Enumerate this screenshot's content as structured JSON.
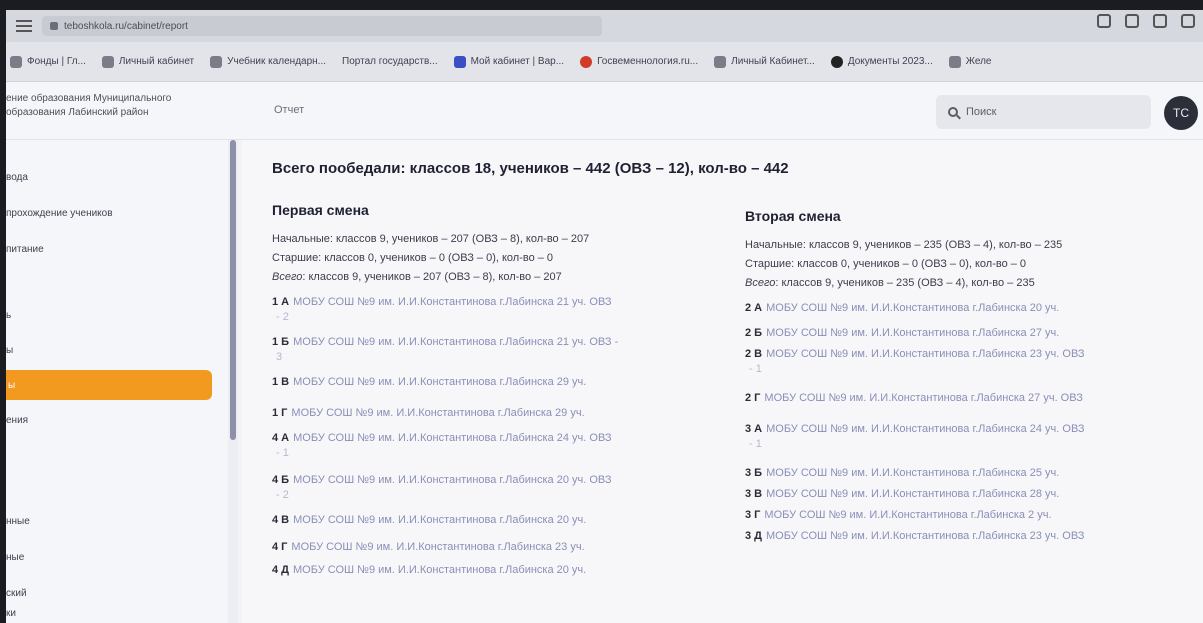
{
  "browser": {
    "url": "teboshkola.ru/cabinet/report",
    "bookmarks": [
      "Фонды | Гл...",
      "Личный кабинет",
      "Учебник календарн...",
      "Портал государств...",
      "Мой кабинет | Вар...",
      "Госвеменнология.ru...",
      "Личный Кабинет...",
      "Документы 2023...",
      "Желе"
    ]
  },
  "header": {
    "org_name": "ение образования Муниципального образования Лабинский район",
    "breadcrumb": "Отчет",
    "search_placeholder": "Поиск",
    "avatar_initials": "ТС"
  },
  "sidebar": {
    "items": [
      "вода",
      "прохождение учеников",
      "питание",
      "ь",
      "ы",
      "ы",
      "ения",
      "нные",
      "ные",
      "ский",
      "ки"
    ]
  },
  "report": {
    "summary": "Всего пообедали: классов 18, учеников – 442 (ОВЗ – 12), кол-во – 442",
    "first_shift": {
      "title": "Первая смена",
      "primary": "Начальные: классов 9, учеников – 207 (ОВЗ – 8), кол-во – 207",
      "senior": "Старшие: классов 0, учеников – 0 (ОВЗ – 0), кол-во – 0",
      "total_label": "Всего",
      "total": ": классов 9, учеников – 207 (ОВЗ – 8), кол-во – 207",
      "classes": [
        {
          "code": "1 А",
          "text": "МОБУ СОШ №9 им. И.И.Константинова г.Лабинска 21 уч. ОВЗ",
          "sub": "- 2"
        },
        {
          "code": "1 Б",
          "text": "МОБУ СОШ №9 им. И.И.Константинова г.Лабинска 21 уч. ОВЗ -",
          "sub": "3"
        },
        {
          "code": "1 В",
          "text": "МОБУ СОШ №9 им. И.И.Константинова г.Лабинска 29 уч.",
          "sub": ""
        },
        {
          "code": "1 Г",
          "text": "МОБУ СОШ №9 им. И.И.Константинова г.Лабинска 29 уч.",
          "sub": ""
        },
        {
          "code": "4 А",
          "text": "МОБУ СОШ №9 им. И.И.Константинова г.Лабинска 24 уч. ОВЗ",
          "sub": "- 1"
        },
        {
          "code": "4 Б",
          "text": "МОБУ СОШ №9 им. И.И.Константинова г.Лабинска 20 уч. ОВЗ",
          "sub": "- 2"
        },
        {
          "code": "4 В",
          "text": "МОБУ СОШ №9 им. И.И.Константинова г.Лабинска 20 уч.",
          "sub": ""
        },
        {
          "code": "4 Г",
          "text": "МОБУ СОШ №9 им. И.И.Константинова г.Лабинска 23 уч.",
          "sub": ""
        },
        {
          "code": "4 Д",
          "text": "МОБУ СОШ №9 им. И.И.Константинова г.Лабинска 20 уч.",
          "sub": ""
        }
      ]
    },
    "second_shift": {
      "title": "Вторая смена",
      "primary": "Начальные: классов 9, учеников – 235 (ОВЗ – 4), кол-во – 235",
      "senior": "Старшие: классов 0, учеников – 0 (ОВЗ – 0), кол-во – 0",
      "total_label": "Всего",
      "total": ": классов 9, учеников – 235 (ОВЗ – 4), кол-во – 235",
      "classes": [
        {
          "code": "2 А",
          "text": "МОБУ СОШ №9 им. И.И.Константинова г.Лабинска 20 уч.",
          "sub": ""
        },
        {
          "code": "2 Б",
          "text": "МОБУ СОШ №9 им. И.И.Константинова г.Лабинска 27 уч.",
          "sub": ""
        },
        {
          "code": "2 В",
          "text": "МОБУ СОШ №9 им. И.И.Константинова г.Лабинска 23 уч. ОВЗ",
          "sub": "- 1"
        },
        {
          "code": "2 Г",
          "text": "МОБУ СОШ №9 им. И.И.Константинова г.Лабинска 27 уч. ОВЗ",
          "sub": ""
        },
        {
          "code": "3 А",
          "text": "МОБУ СОШ №9 им. И.И.Константинова г.Лабинска 24 уч. ОВЗ",
          "sub": "- 1"
        },
        {
          "code": "3 Б",
          "text": "МОБУ СОШ №9 им. И.И.Константинова г.Лабинска 25 уч.",
          "sub": ""
        },
        {
          "code": "3 В",
          "text": "МОБУ СОШ №9 им. И.И.Константинова г.Лабинска 28 уч.",
          "sub": ""
        },
        {
          "code": "3 Г",
          "text": "МОБУ СОШ №9 им. И.И.Константинова г.Лабинска 2 уч.",
          "sub": ""
        },
        {
          "code": "3 Д",
          "text": "МОБУ СОШ №9 им. И.И.Константинова г.Лабинска 23 уч. ОВЗ",
          "sub": ""
        }
      ]
    }
  }
}
